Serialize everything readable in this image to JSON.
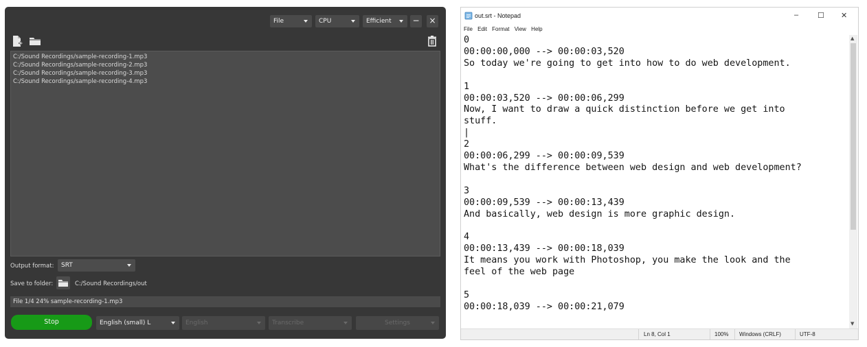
{
  "app": {
    "header": {
      "mode": "File",
      "device": "CPU",
      "quality": "Efficient",
      "minimize": "−",
      "close": "×"
    },
    "files": [
      "C:/Sound Recordings/sample-recording-1.mp3",
      "C:/Sound Recordings/sample-recording-2.mp3",
      "C:/Sound Recordings/sample-recording-3.mp3",
      "C:/Sound Recordings/sample-recording-4.mp3"
    ],
    "output_format_label": "Output format:",
    "output_format": "SRT",
    "save_folder_label": "Save to folder:",
    "save_folder": "C:/Sound Recordings/out",
    "status": "File 1/4  24%  sample-recording-1.mp3",
    "stop_label": "Stop",
    "model": "English (small) L",
    "language": "English",
    "task": "Transcribe",
    "settings_label": "Settings"
  },
  "notepad": {
    "title": "out.srt - Notepad",
    "controls": {
      "minimize": "–",
      "maximize": "☐",
      "close": "✕"
    },
    "menu": [
      "File",
      "Edit",
      "Format",
      "View",
      "Help"
    ],
    "content": "0\n00:00:00,000 --> 00:00:03,520\nSo today we're going to get into how to do web development.\n\n1\n00:00:03,520 --> 00:00:06,299\nNow, I want to draw a quick distinction before we get into\nstuff.\n|\n2\n00:00:06,299 --> 00:00:09,539\nWhat's the difference between web design and web development?\n\n3\n00:00:09,539 --> 00:00:13,439\nAnd basically, web design is more graphic design.\n\n4\n00:00:13,439 --> 00:00:18,039\nIt means you work with Photoshop, you make the look and the\nfeel of the web page\n\n5\n00:00:18,039 --> 00:00:21,079",
    "status": {
      "position": "Ln 8, Col 1",
      "zoom": "100%",
      "line_ending": "Windows (CRLF)",
      "encoding": "UTF-8"
    }
  }
}
